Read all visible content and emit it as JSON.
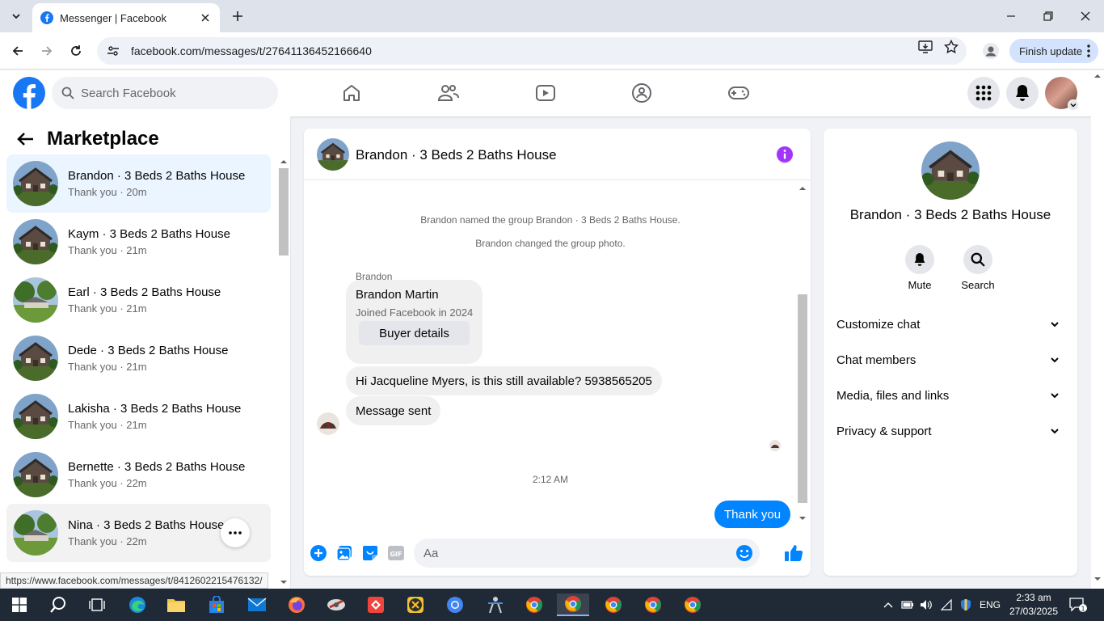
{
  "browser": {
    "tab_title": "Messenger | Facebook",
    "url": "facebook.com/messages/t/27641136452166640",
    "finish_update_label": "Finish update",
    "status_url": "https://www.facebook.com/messages/t/8412602215476132/"
  },
  "fb": {
    "search_placeholder": "Search Facebook",
    "brand_color": "#1877f2",
    "nav_icons": [
      "home-icon",
      "friends-icon",
      "watch-icon",
      "groups-icon",
      "gaming-icon"
    ]
  },
  "left_panel": {
    "title": "Marketplace",
    "conversations": [
      {
        "name": "Brandon · 3 Beds 2 Baths House",
        "preview": "Thank you · 20m"
      },
      {
        "name": "Kaym · 3 Beds 2 Baths House",
        "preview": "Thank you · 21m"
      },
      {
        "name": "Earl · 3 Beds 2 Baths House",
        "preview": "Thank you · 21m"
      },
      {
        "name": "Dede · 3 Beds 2 Baths House",
        "preview": "Thank you · 21m"
      },
      {
        "name": "Lakisha · 3 Beds 2 Baths House",
        "preview": "Thank you · 21m"
      },
      {
        "name": "Bernette · 3 Beds 2 Baths House",
        "preview": "Thank you · 22m"
      },
      {
        "name": "Nina · 3 Beds 2 Baths House",
        "preview": "Thank you · 22m"
      }
    ]
  },
  "chat": {
    "title": "Brandon · 3 Beds 2 Baths House",
    "system_messages": [
      "Brandon named the group Brandon · 3 Beds 2 Baths House.",
      "Brandon changed the group photo."
    ],
    "sender_label": "Brandon",
    "card": {
      "name": "Brandon Martin",
      "subtitle": "Joined Facebook in 2024",
      "button": "Buyer details"
    },
    "incoming": [
      "Hi Jacqueline Myers, is this still available? 5938565205",
      "Message sent"
    ],
    "timestamp": "2:12 AM",
    "outgoing": "Thank you",
    "composer_placeholder": "Aa",
    "accent_color": "#0084ff"
  },
  "info_panel": {
    "name": "Brandon · 3 Beds 2 Baths House",
    "actions": [
      {
        "label": "Mute",
        "icon": "bell-icon"
      },
      {
        "label": "Search",
        "icon": "search-icon"
      }
    ],
    "sections": [
      "Customize chat",
      "Chat members",
      "Media, files and links",
      "Privacy & support"
    ]
  },
  "taskbar": {
    "language": "ENG",
    "time": "2:33 am",
    "date": "27/03/2025"
  }
}
